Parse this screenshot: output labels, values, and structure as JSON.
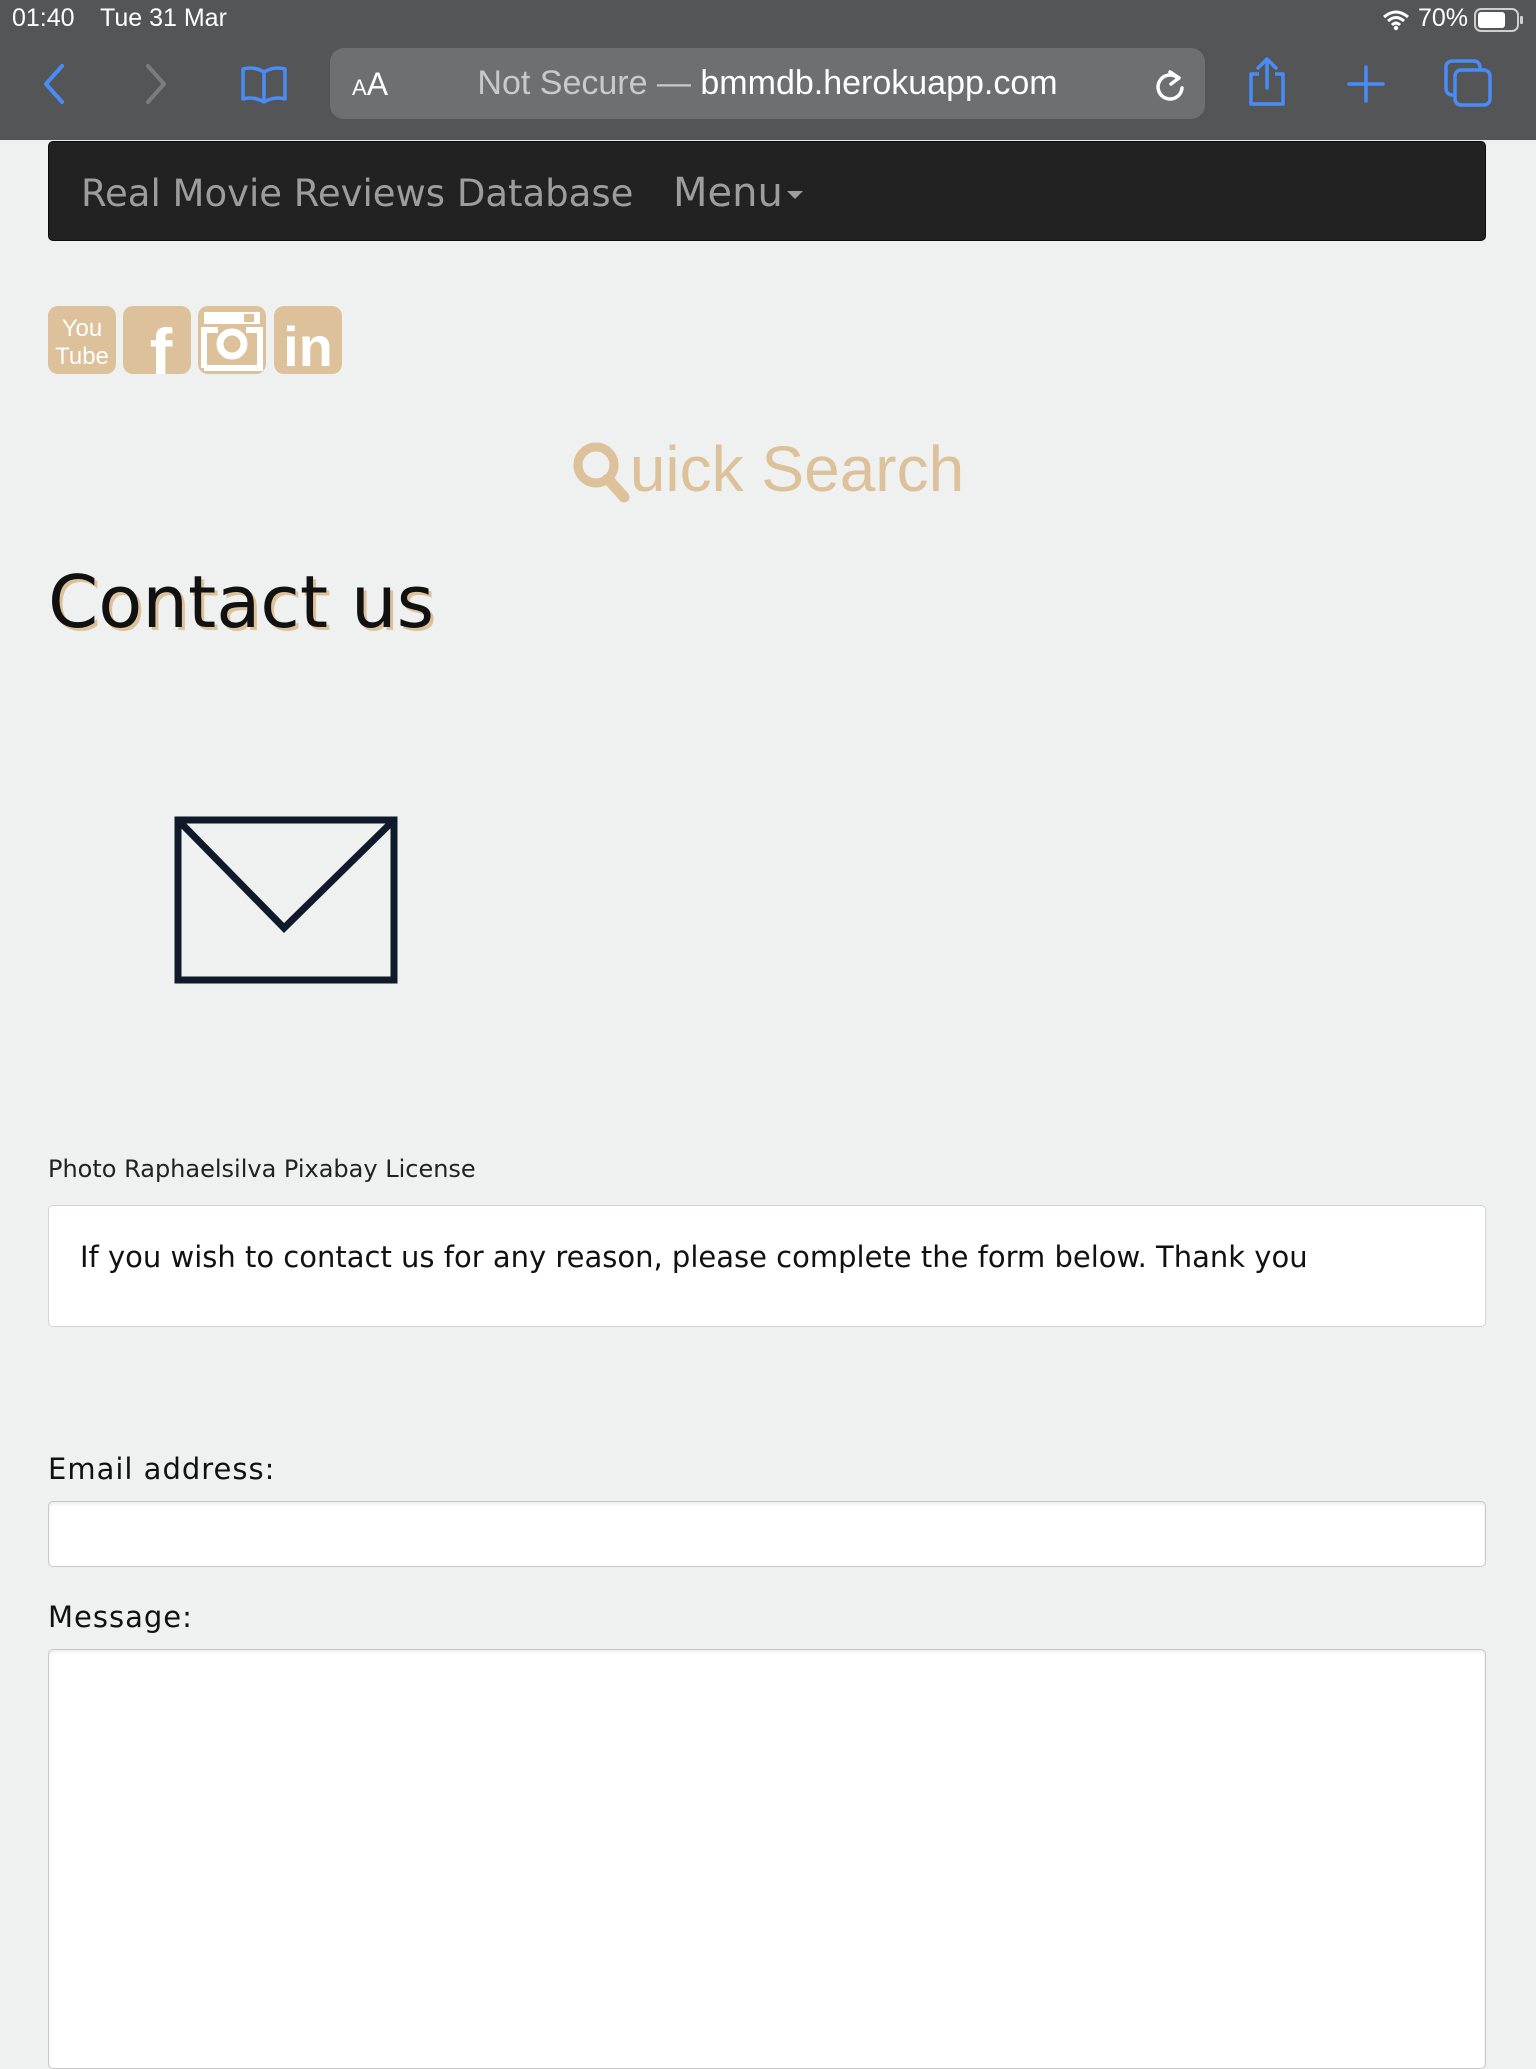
{
  "status_bar": {
    "time": "01:40",
    "date": "Tue 31 Mar",
    "battery": "70%"
  },
  "browser": {
    "text_size_small": "A",
    "text_size_big": "A",
    "security": "Not Secure —",
    "domain": "bmmdb.herokuapp.com",
    "icons": [
      "back-icon",
      "forward-icon",
      "bookmarks-icon",
      "reload-icon",
      "share-icon",
      "new-tab-icon",
      "tabs-icon"
    ]
  },
  "navbar": {
    "brand": "Real Movie Reviews Database",
    "menu_label": "Menu"
  },
  "social": {
    "youtube_top": "You",
    "youtube_bottom": "Tube",
    "facebook": "f",
    "linkedin": "in",
    "icon_color": "#dcc19a"
  },
  "quick_search": {
    "first_letter": "Q",
    "rest": "uick Search"
  },
  "page": {
    "title": "Contact us",
    "image_caption": "Photo Raphaelsilva Pixabay License",
    "intro": "If you wish to contact us for any reason, please complete the form below. Thank you"
  },
  "form": {
    "email_label": "Email address:",
    "email_value": "",
    "message_label": "Message:",
    "message_value": ""
  },
  "colors": {
    "accent": "#dcc19a",
    "navbar": "#222222",
    "browser_chrome": "#545556",
    "ios_blue": "#4a8cf7"
  }
}
